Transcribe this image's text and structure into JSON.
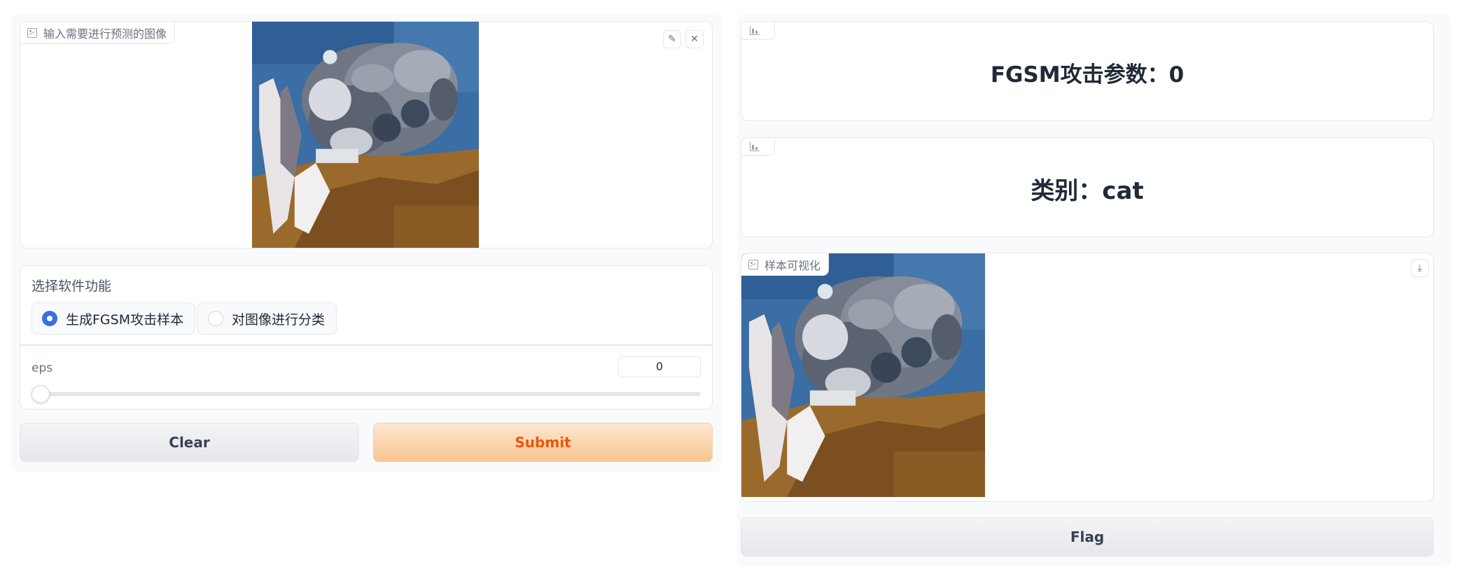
{
  "input_image": {
    "label": "输入需要进行预测的图像",
    "edit_icon": "pencil-icon",
    "clear_icon": "close-icon"
  },
  "function_select": {
    "label": "选择软件功能",
    "options": [
      "生成FGSM攻击样本",
      "对图像进行分类"
    ],
    "selected": "生成FGSM攻击样本"
  },
  "eps_slider": {
    "label": "eps",
    "value": "0",
    "level": 0
  },
  "buttons": {
    "clear": "Clear",
    "submit": "Submit",
    "flag": "Flag"
  },
  "outputs": {
    "fgsm_param": "FGSM攻击参数：0",
    "category": "类别：cat",
    "sample_label": "样本可视化",
    "download_icon": "download-icon"
  },
  "colors": {
    "accent": "#3b6fe0",
    "primary_button": "#f7c48f",
    "primary_text": "#ea580c"
  }
}
